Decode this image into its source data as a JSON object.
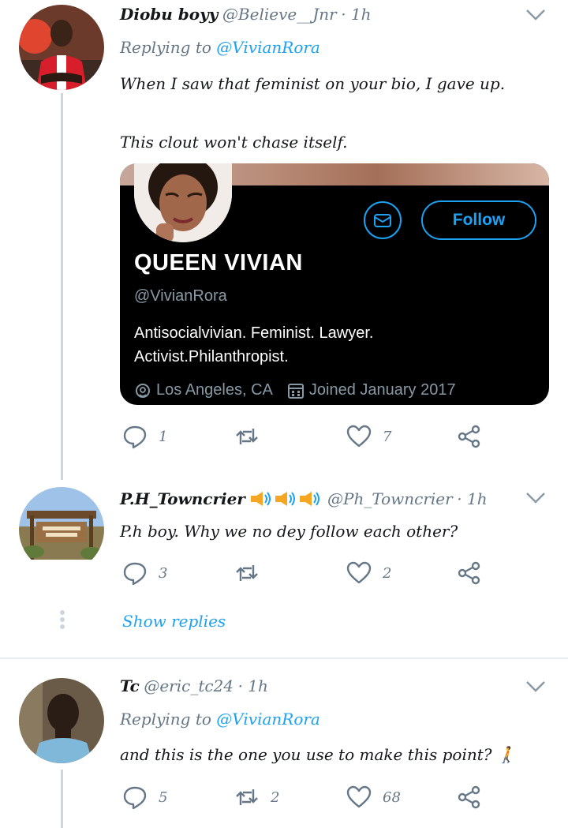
{
  "tweets": [
    {
      "name": "Diobu boyy",
      "handle": "@Believe__Jnr",
      "time": "· 1h",
      "replying_prefix": "Replying to",
      "replying_to": "@VivianRora",
      "line1": "When I saw that feminist on your bio, I gave up.",
      "line2": "This clout won't chase itself.",
      "replies": "1",
      "retweets": "",
      "likes": "7"
    },
    {
      "name": "P.H_Towncrier",
      "handle": "@Ph_Towncrier",
      "time": "· 1h",
      "line1": "P.h boy. Why we no dey follow each other?",
      "replies": "3",
      "retweets": "",
      "likes": "2",
      "show_replies": "Show replies"
    },
    {
      "name": "Tc",
      "handle": "@eric_tc24",
      "time": "· 1h",
      "replying_prefix": "Replying to",
      "replying_to": "@VivianRora",
      "line1": "and this is the one you use to make this point? 🚶",
      "replies": "5",
      "retweets": "2",
      "likes": "68"
    }
  ],
  "card": {
    "name": "QUEEN VIVIAN",
    "handle": "@VivianRora",
    "bio_line1": "Antisocialvivian. Feminist. Lawyer.",
    "bio_line2": "Activist.Philanthropist.",
    "location": "Los Angeles, CA",
    "joined": "Joined January 2017",
    "follow_label": "Follow"
  },
  "icons": [
    "chevron-down-icon",
    "reply-icon",
    "retweet-icon",
    "like-icon",
    "share-icon",
    "mail-icon",
    "location-icon",
    "calendar-icon",
    "speaker-icon"
  ],
  "colors": {
    "accent": "#1da1f2",
    "muted": "#657786",
    "card_bg": "#000000"
  }
}
